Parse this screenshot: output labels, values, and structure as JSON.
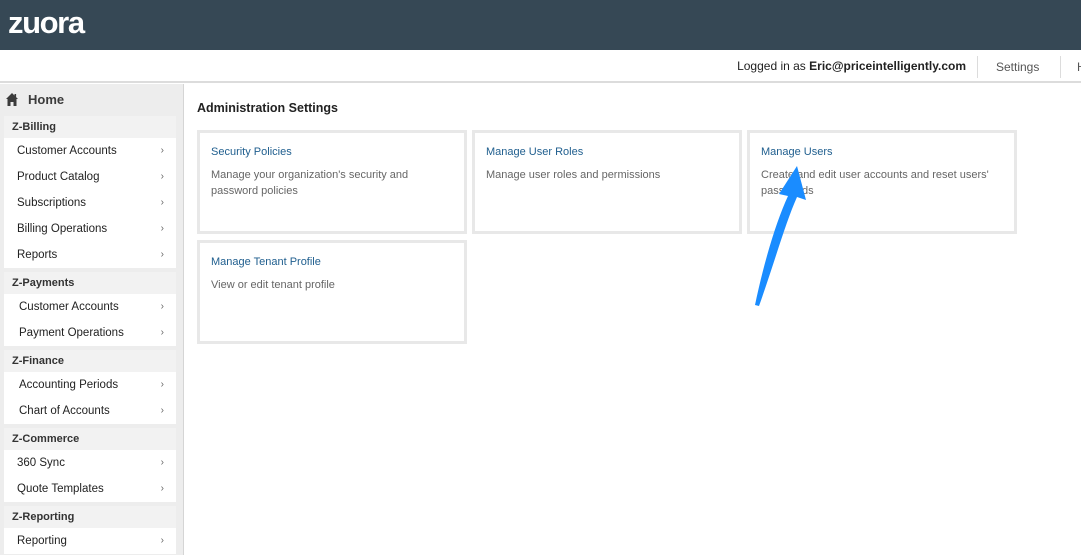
{
  "app": {
    "logo": "zuora"
  },
  "userbar": {
    "logged_prefix": "Logged in as ",
    "user_email": "Eric@priceintelligently.com",
    "settings": "Settings",
    "help_partial": "H"
  },
  "sidebar": {
    "home": "Home",
    "sections": [
      {
        "title": "Z-Billing",
        "items": [
          "Customer Accounts",
          "Product Catalog",
          "Subscriptions",
          "Billing Operations",
          "Reports"
        ]
      },
      {
        "title": "Z-Payments",
        "items": [
          "Customer Accounts",
          "Payment Operations"
        ]
      },
      {
        "title": "Z-Finance",
        "items": [
          "Accounting Periods",
          "Chart of Accounts"
        ]
      },
      {
        "title": "Z-Commerce",
        "items": [
          "360 Sync",
          "Quote Templates"
        ]
      },
      {
        "title": "Z-Reporting",
        "items": [
          "Reporting"
        ]
      }
    ],
    "chevron": "›"
  },
  "main": {
    "title": "Administration Settings",
    "cards": [
      {
        "title": "Security Policies",
        "desc": "Manage your organization's security and password policies"
      },
      {
        "title": "Manage User Roles",
        "desc": "Manage user roles and permissions"
      },
      {
        "title": "Manage Users",
        "desc": "Create and edit user accounts and reset users' passwords"
      },
      {
        "title": "Manage Tenant Profile",
        "desc": "View or edit tenant profile"
      }
    ]
  },
  "annotation": {
    "arrow_color": "#1a8cff"
  }
}
